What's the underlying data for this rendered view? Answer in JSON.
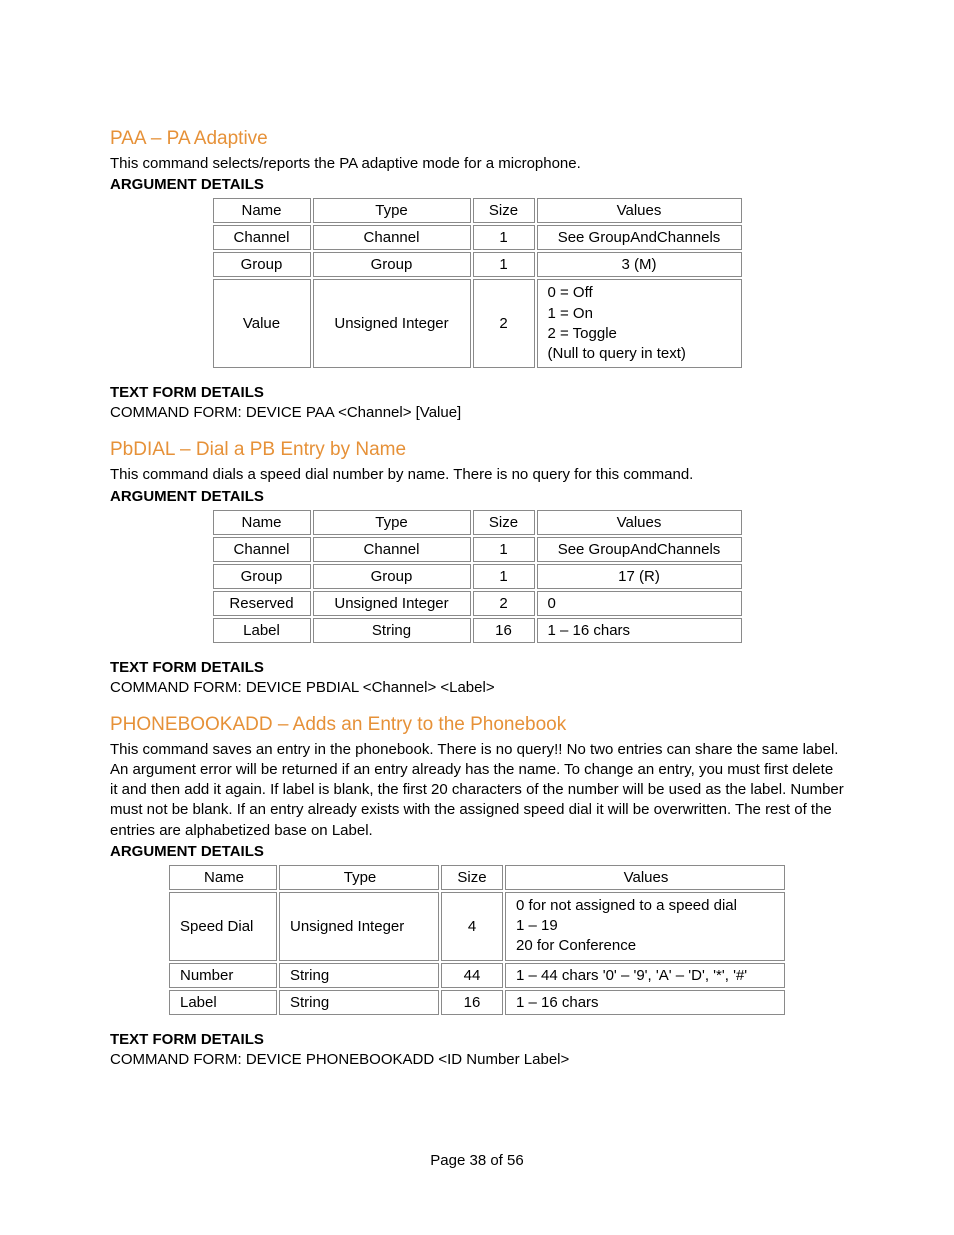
{
  "footer": {
    "text": "Page 38 of 56"
  },
  "headers": {
    "name": "Name",
    "type": "Type",
    "size": "Size",
    "values": "Values"
  },
  "labels": {
    "argDetails": "ARGUMENT DETAILS",
    "textForm": "TEXT FORM DETAILS"
  },
  "sections": {
    "paa": {
      "title": "PAA – PA Adaptive",
      "desc": "This command selects/reports the PA adaptive mode for a microphone.",
      "rows": [
        {
          "name": "Channel",
          "type": "Channel",
          "size": "1",
          "values": "See GroupAndChannels",
          "center": true
        },
        {
          "name": "Group",
          "type": "Group",
          "size": "1",
          "values": "3 (M)",
          "center": true
        },
        {
          "name": "Value",
          "type": "Unsigned Integer",
          "size": "2",
          "values": "0 = Off\n1 = On\n2 = Toggle\n(Null to query in text)"
        }
      ],
      "commandForm": "COMMAND FORM: DEVICE PAA <Channel> [Value]"
    },
    "pbdial": {
      "title": "PbDIAL – Dial a PB Entry by Name",
      "desc": "This command dials a speed dial number by name. There is no query for this command.",
      "rows": [
        {
          "name": "Channel",
          "type": "Channel",
          "size": "1",
          "values": "See GroupAndChannels",
          "center": true
        },
        {
          "name": "Group",
          "type": "Group",
          "size": "1",
          "values": "17 (R)",
          "center": true
        },
        {
          "name": "Reserved",
          "type": "Unsigned Integer",
          "size": "2",
          "values": "0"
        },
        {
          "name": "Label",
          "type": "String",
          "size": "16",
          "values": "1 – 16 chars"
        }
      ],
      "commandForm": "COMMAND FORM: DEVICE PBDIAL <Channel> <Label>"
    },
    "phonebookadd": {
      "title": "PHONEBOOKADD – Adds an Entry to the Phonebook",
      "desc": "This command saves an entry in the phonebook.  There is no query!!  No two entries can share the same label.  An argument error will be returned if an entry already has the name.  To change an entry, you must first delete it and then add it again. If label is blank, the first 20 characters of the number will be used as the label.  Number must not be blank.  If an entry already exists with the assigned speed dial it will be overwritten. The rest of the entries are alphabetized base on Label.",
      "rows": [
        {
          "name": "Speed Dial",
          "type": "Unsigned Integer",
          "size": "4",
          "values": "0 for not assigned to a speed dial\n1 – 19\n20 for Conference"
        },
        {
          "name": "Number",
          "type": "String",
          "size": "44",
          "values": "1 – 44 chars '0' – '9', 'A' – 'D', '*', '#'"
        },
        {
          "name": "Label",
          "type": "String",
          "size": "16",
          "values": "1 – 16 chars"
        }
      ],
      "commandForm": "COMMAND FORM: DEVICE PHONEBOOKADD <ID Number Label>"
    }
  }
}
